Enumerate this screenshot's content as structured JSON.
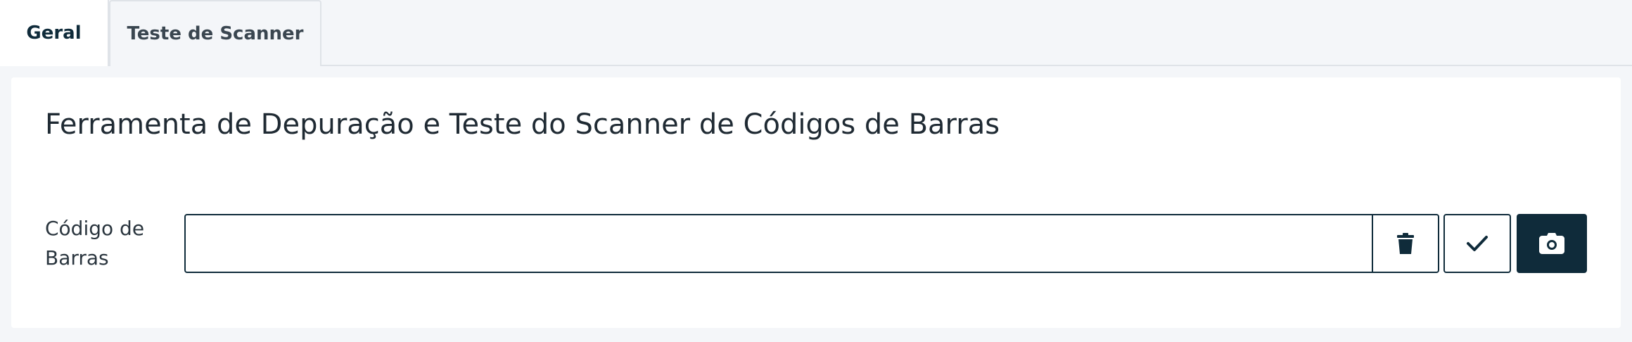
{
  "tabs": [
    {
      "label": "Geral",
      "active": true
    },
    {
      "label": "Teste de Scanner",
      "active": false
    }
  ],
  "main": {
    "title": "Ferramenta de Depuração e Teste do Scanner de Códigos de Barras",
    "barcode": {
      "label": "Código de Barras",
      "value": "",
      "placeholder": ""
    },
    "actions": {
      "clear_icon": "trash-icon",
      "confirm_icon": "check-icon",
      "camera_icon": "camera-icon"
    }
  },
  "colors": {
    "primary": "#0f2b3a",
    "background": "#f4f6f9",
    "card": "#ffffff",
    "border": "#dfe3e8"
  }
}
